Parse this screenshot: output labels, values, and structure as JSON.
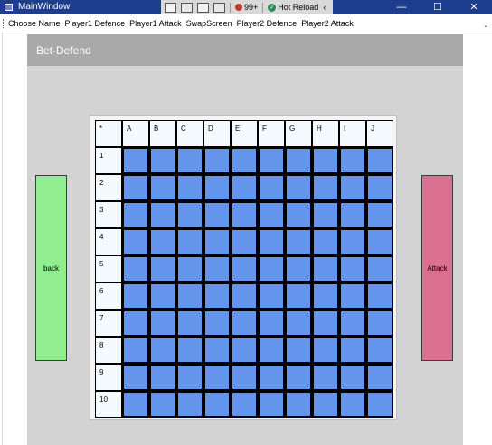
{
  "window": {
    "title": "MainWindow",
    "minimize": "—",
    "maximize": "☐",
    "close": "✕"
  },
  "devbar": {
    "issues_count": "99+",
    "hot_reload": "Hot Reload",
    "collapse": "‹"
  },
  "menu": {
    "items": [
      "Choose Name",
      "Player1 Defence",
      "Player1 Attack",
      "SwapScreen",
      "Player2 Defence",
      "Player2 Attack"
    ],
    "overflow": "⌄"
  },
  "header": {
    "title": "Bet-Defend"
  },
  "board": {
    "corner": "*",
    "columns": [
      "A",
      "B",
      "C",
      "D",
      "E",
      "F",
      "G",
      "H",
      "I",
      "J"
    ],
    "rows": [
      "1",
      "2",
      "3",
      "4",
      "5",
      "6",
      "7",
      "8",
      "9",
      "10"
    ]
  },
  "buttons": {
    "back": "back",
    "attack": "Attack"
  },
  "colors": {
    "titlebar": "#1e3d8c",
    "cell_blue": "#6495ed",
    "back_green": "#90ee90",
    "attack_pink": "#db7093"
  }
}
